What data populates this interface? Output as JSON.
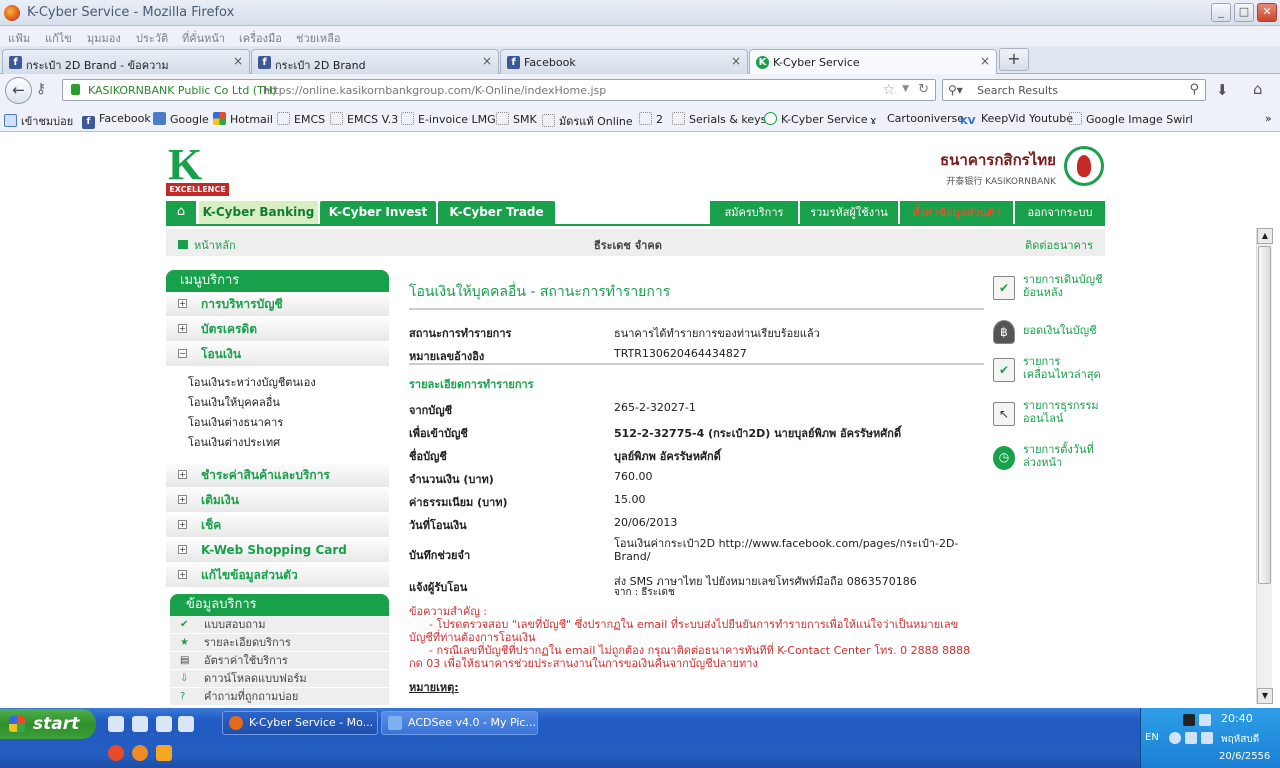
{
  "window": {
    "title": "K-Cyber Service - Mozilla Firefox"
  },
  "menu": [
    "แฟ้ม",
    "แก้ไข",
    "มุมมอง",
    "ประวัติ",
    "ที่คั่นหน้า",
    "เครื่องมือ",
    "ช่วยเหลือ"
  ],
  "tabs": [
    {
      "label": "กระเป๋า 2D Brand - ข้อความ",
      "close": "×"
    },
    {
      "label": "กระเป๋า 2D Brand",
      "close": "×"
    },
    {
      "label": "Facebook",
      "close": "×"
    },
    {
      "label": "K-Cyber Service",
      "close": "×"
    }
  ],
  "newtab": "+",
  "nav": {
    "identity": "KASIKORNBANK Public Co Ltd (TH)",
    "url": "https://online.kasikornbankgroup.com/K-Online/indexHome.jsp",
    "search_placeholder": "Search Results"
  },
  "bookmarks": [
    "เข้าชมบ่อย",
    "Facebook",
    "Google",
    "Hotmail",
    "EMCS",
    "EMCS V.3",
    "E-invoice LMG",
    "SMK",
    "มัดรแท้ Online",
    "2",
    "Serials & keys",
    "K-Cyber Service",
    "Cartooniverse",
    "KeepVid Youtube",
    "Google Image Swirl"
  ],
  "bookmark_more": "»",
  "bank": {
    "logo_letter": "K",
    "logo_band": "EXCELLENCE",
    "name_th": "ธนาคารกสิกรไทย",
    "name_en": "开泰银行 KASIKORNBANK"
  },
  "topnav": {
    "home_icon": "⌂",
    "tabs": [
      "K-Cyber Banking",
      "K-Cyber Invest",
      "K-Cyber Trade"
    ],
    "right": [
      "สมัครบริการ",
      "รวมรหัสผู้ใช้งาน",
      "ตั้งค่าข้อมูลส่วนตัว",
      "ออกจากระบบ"
    ]
  },
  "subbar": {
    "home": "หน้าหลัก",
    "name": "ธีระเดช จำคด",
    "contact": "ติดต่อธนาคาร"
  },
  "leftmenu": {
    "title": "เมนูบริการ",
    "items": [
      {
        "sign": "+",
        "label": "การบริหารบัญชี"
      },
      {
        "sign": "+",
        "label": "บัตรเครดิต"
      },
      {
        "sign": "−",
        "label": "โอนเงิน"
      }
    ],
    "sub": [
      "โอนเงินระหว่างบัญชีตนเอง",
      "โอนเงินให้บุคคลอื่น",
      "โอนเงินต่างธนาคาร",
      "โอนเงินต่างประเทศ"
    ],
    "items2": [
      {
        "sign": "+",
        "label": "ชำระค่าสินค้าและบริการ"
      },
      {
        "sign": "+",
        "label": "เติมเงิน"
      },
      {
        "sign": "+",
        "label": "เช็ค"
      },
      {
        "sign": "+",
        "label": "K-Web Shopping Card"
      },
      {
        "sign": "+",
        "label": "แก้ไขข้อมูลส่วนตัว"
      }
    ]
  },
  "infomenu": {
    "title": "ข้อมูลบริการ",
    "items": [
      {
        "icon": "✔",
        "label": "แบบสอบถาม"
      },
      {
        "icon": "★",
        "label": "รายละเอียดบริการ"
      },
      {
        "icon": "▤",
        "label": "อัตราค่าใช้บริการ"
      },
      {
        "icon": "⇩",
        "label": "ดาวน์โหลดแบบฟอร์ม"
      },
      {
        "icon": "?",
        "label": "คำถามที่ถูกถามบ่อย"
      }
    ]
  },
  "main": {
    "title": "โอนเงินให้บุคคลอื่น - สถานะการทำรายการ",
    "status_rows": [
      {
        "k": "สถานะการทำรายการ",
        "v": "ธนาคารได้ทำรายการของท่านเรียบร้อยแล้ว"
      },
      {
        "k": "หมายเลขอ้างอิง",
        "v": "TRTR130620464434827"
      }
    ],
    "detail_title": "รายละเอียดการทำรายการ",
    "rows": [
      {
        "k": "จากบัญชี",
        "v": "265-2-32027-1"
      },
      {
        "k": "เพื่อเข้าบัญชี",
        "v": "512-2-32775-4 (กระเป๋า2D) นายบุลย์พิภพ อัครรัษหศักดิ์"
      },
      {
        "k": "ชื่อบัญชี",
        "v": "บุลย์พิภพ อัครรัษหศักดิ์"
      },
      {
        "k": "จำนวนเงิน (บาท)",
        "v": "760.00"
      },
      {
        "k": "ค่าธรรมเนียม (บาท)",
        "v": "15.00"
      },
      {
        "k": "วันที่โอนเงิน",
        "v": "20/06/2013"
      }
    ],
    "memo_k": "บันทึกช่วยจำ",
    "memo_v": "โอนเงินค่ากระเป๋า2D http://www.facebook.com/pages/กระเป๋า-2D-Brand/",
    "notify_k": "แจ้งผู้รับโอน",
    "notify_v1": "ส่ง SMS ภาษาไทย ไปยังหมายเลขโทรศัพท์มือถือ 0863570186",
    "notify_v2": "จาก : ธีระเดช",
    "warn_title": "ข้อความสำคัญ :",
    "warn1": "- โปรดตรวจสอบ \"เลขที่บัญชี\" ซึ่งปรากฏใน email ที่ระบบส่งไปยืนยันการทำรายการเพื่อให้แน่ใจว่าเป็นหมายเลขบัญชีที่ท่านต้องการโอนเงิน",
    "warn2": "- กรณีเลขที่บัญชีที่ปรากฏใน email ไม่ถูกต้อง กรุณาติดต่อธนาคารทันทีที่ K-Contact Center โทร. 0 2888 8888 กด 03 เพื่อให้ธนาคารช่วยประสานงานในการขอเงินคืนจากบัญชีปลายทาง",
    "note": "หมายเหตุ:"
  },
  "rightcol": [
    {
      "icon": "✔",
      "label": "รายการเดินบัญชีย้อนหลัง"
    },
    {
      "icon": "฿",
      "label": "ยอดเงินในบัญชี"
    },
    {
      "icon": "✔",
      "label": "รายการเคลื่อนไหวล่าสุด"
    },
    {
      "icon": "↖",
      "label": "รายการธุรกรรมออนไลน์"
    },
    {
      "icon": "◷",
      "label": "รายการตั้งวันที่ล่วงหน้า"
    }
  ],
  "taskbar": {
    "start": "start",
    "buttons": [
      "K-Cyber Service - Mo...",
      "ACDSee v4.0 - My Pic..."
    ],
    "lang": "EN",
    "time": "20:40",
    "day": "พฤหัสบดี",
    "date": "20/6/2556"
  }
}
